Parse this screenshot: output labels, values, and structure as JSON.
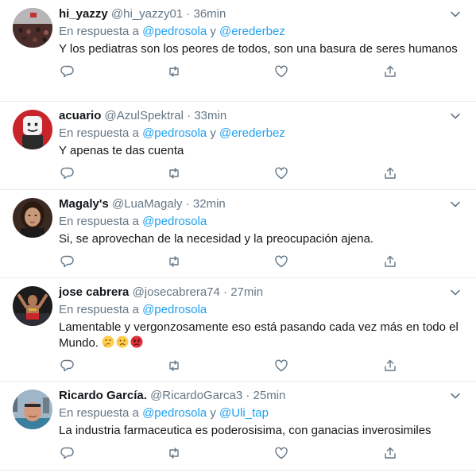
{
  "tweets": [
    {
      "name": "hi_yazzy",
      "handle": "@hi_yazzy01",
      "time": "36min",
      "reply_prefix": "En respuesta a",
      "mention1": "@pedrosola",
      "joiner": "y",
      "mention2": "@erederbez",
      "text": "Y los pediatras son los peores de todos, son una basura de seres humanos",
      "avatar_icon": "avatar-crowd-photo"
    },
    {
      "name": "acuario",
      "handle": "@AzulSpektral",
      "time": "33min",
      "reply_prefix": "En respuesta a",
      "mention1": "@pedrosola",
      "joiner": "y",
      "mention2": "@erederbez",
      "text": "Y apenas te das cuenta",
      "avatar_icon": "avatar-marshmello-photo"
    },
    {
      "name": "Magaly's",
      "handle": "@LuaMagaly",
      "time": "32min",
      "reply_prefix": "En respuesta a",
      "mention1": "@pedrosola",
      "text": "Si, se aprovechan de la necesidad y la preocupación ajena.",
      "avatar_icon": "avatar-woman-photo"
    },
    {
      "name": "jose cabrera",
      "handle": "@josecabrera74",
      "time": "27min",
      "reply_prefix": "En respuesta a",
      "mention1": "@pedrosola",
      "text": "Lamentable y vergonzosamente eso está pasando cada vez más en todo el Mundo.",
      "emojis": [
        "thinking-face-emoji",
        "frowning-face-emoji",
        "angry-face-emoji"
      ],
      "avatar_icon": "avatar-wrestler-photo"
    },
    {
      "name": "Ricardo García.",
      "handle": "@RicardoGarca3",
      "time": "25min",
      "reply_prefix": "En respuesta a",
      "mention1": "@pedrosola",
      "joiner": "y",
      "mention2": "@Uli_tap",
      "text": "La industria farmaceutica es poderosisima, con ganacias inverosimiles",
      "avatar_icon": "avatar-man-city-photo"
    }
  ],
  "actions": [
    "reply-icon",
    "retweet-icon",
    "like-icon",
    "share-icon"
  ],
  "colors": {
    "accent": "#1da1f2",
    "secondary": "#657786",
    "text": "#14171a",
    "divider": "#e6ecf0"
  }
}
